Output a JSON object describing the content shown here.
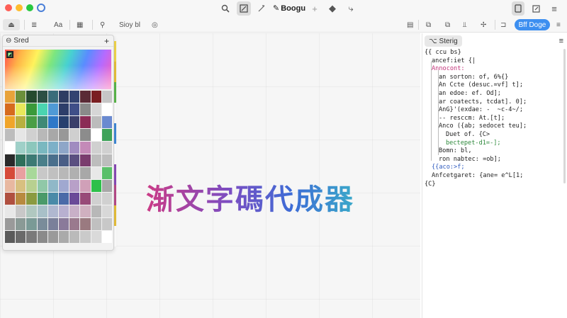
{
  "window": {
    "title": "Boogu",
    "title_icon": "brush-icon"
  },
  "titlebar": {
    "icons": [
      "search-icon",
      "edit-icon",
      "pen-icon",
      "sparkle-icon",
      "fill-icon",
      "link-icon",
      "page-icon",
      "export-icon",
      "list-icon"
    ]
  },
  "toolbar": {
    "aa_label": "Aa",
    "style_label": "Sioy bl",
    "action_button": "Bff Doge"
  },
  "canvas": {
    "title": "渐文字碼代成器"
  },
  "swatch_panel": {
    "title": "Sred",
    "add_label": "+",
    "rows": [
      [
        "#e8a33a",
        "#6b8f3a",
        "#254a2e",
        "#2c4f44",
        "#3a6c7a",
        "#2e3d63",
        "#324370",
        "#5a2a35",
        "#7a1f22",
        "#c6c6c6"
      ],
      [
        "#d66b1e",
        "#e8e85a",
        "#3a9a3a",
        "#4bd4b0",
        "#4f9ad6",
        "#2d3e6a",
        "#3f4f88",
        "#8a8a8a",
        "#d6d6d6",
        "#ffffff"
      ],
      [
        "#f0a52a",
        "#b8b040",
        "#4a9e46",
        "#3f8a76",
        "#2e78c8",
        "#27406e",
        "#3a3f6a",
        "#8b2c56",
        "#bcbcbc",
        "#6a8ad0"
      ],
      [
        "#bdbdbd",
        "#e6e6e6",
        "#d0d0d0",
        "#b8b8b8",
        "#a8a8a8",
        "#989898",
        "#cfcfcf",
        "#8c8c8c",
        "#ffffff",
        "#3fa35a"
      ],
      [
        "#ffffff",
        "#9fd0c8",
        "#8cc7bc",
        "#7ab8c0",
        "#7cb0c8",
        "#8ea6c8",
        "#a08cc0",
        "#c48ab8",
        "#d0d0d0",
        "#d0d0d0"
      ],
      [
        "#2a2a2a",
        "#2f6f5a",
        "#3c7a74",
        "#4a7f8a",
        "#4a6f8c",
        "#4a5e86",
        "#5a4f80",
        "#7a3c6e",
        "#bdbdbd",
        "#bdbdbd"
      ],
      [
        "#d64a3a",
        "#e8a0a0",
        "#a8d89a",
        "#c8c8c8",
        "#c0c0c0",
        "#b8b8b8",
        "#b0b0b0",
        "#a8a8a8",
        "#e8e8e8",
        "#5ac06a"
      ],
      [
        "#e8b8a0",
        "#d8c080",
        "#b8d090",
        "#90c8a8",
        "#90b8c8",
        "#a0a8d0",
        "#b8a0c8",
        "#d0a0b8",
        "#2ec04a",
        "#a8a8a8"
      ],
      [
        "#b05040",
        "#b88a40",
        "#8a9a40",
        "#4a9a6a",
        "#4a8aa8",
        "#4a6aa8",
        "#6a4a98",
        "#984a78",
        "#d0d0d0",
        "#d0d0d0"
      ],
      [
        "#e8e8e8",
        "#c8c8c8",
        "#b0c8c0",
        "#a8c0c8",
        "#b0b8d0",
        "#b8b0d0",
        "#c8b0c8",
        "#d0b0c0",
        "#b8b8b8",
        "#d8d8d8"
      ],
      [
        "#9a9a9a",
        "#8a9a96",
        "#7a9a96",
        "#7a8c9a",
        "#7a809a",
        "#8a7a9a",
        "#9a7a8e",
        "#9a7a80",
        "#c0c0c0",
        "#c8c8c8"
      ],
      [
        "#5a5a5a",
        "#6a6a6a",
        "#7a7a7a",
        "#8a8a8a",
        "#9a9a9a",
        "#aaaaaa",
        "#bababa",
        "#cacaca",
        "#dadada",
        "#ffffff"
      ]
    ]
  },
  "code_panel": {
    "tab": "Sterig",
    "lines": [
      {
        "indent": 0,
        "text": "{{ ccu bs}"
      },
      {
        "indent": 1,
        "text": "ancef:iet {|"
      },
      {
        "indent": 1,
        "text": "Annocont:",
        "cls": "k"
      },
      {
        "indent": 2,
        "text": "an sorton: of, 6%{}"
      },
      {
        "indent": 2,
        "text": "An Ccte (desuc.=vf] t];"
      },
      {
        "indent": 2,
        "text": "an edoe: ef. Od];"
      },
      {
        "indent": 2,
        "text": "ar coatects, tcdat]. 0];"
      },
      {
        "indent": 2,
        "text": "AnG}'(exdae: -  ~c-4~/;"
      },
      {
        "indent": 2,
        "text": "-- resccm: At.[t];"
      },
      {
        "indent": 2,
        "text": "Anco ({ab; sedocet teu];"
      },
      {
        "indent": 3,
        "text": "Duet of. {C>"
      },
      {
        "indent": 3,
        "text": "bectepet-d1=-];",
        "cls": "g"
      },
      {
        "indent": 2,
        "text": "Bomn: bl,"
      },
      {
        "indent": 2,
        "text": "ron nabtec: =ob];"
      },
      {
        "indent": 1,
        "text": "{{aco:>f;",
        "cls": "b"
      },
      {
        "indent": 1,
        "text": "Anfcetgaret: {ane= e^L[1;"
      },
      {
        "indent": 0,
        "text": "{C}"
      }
    ]
  }
}
